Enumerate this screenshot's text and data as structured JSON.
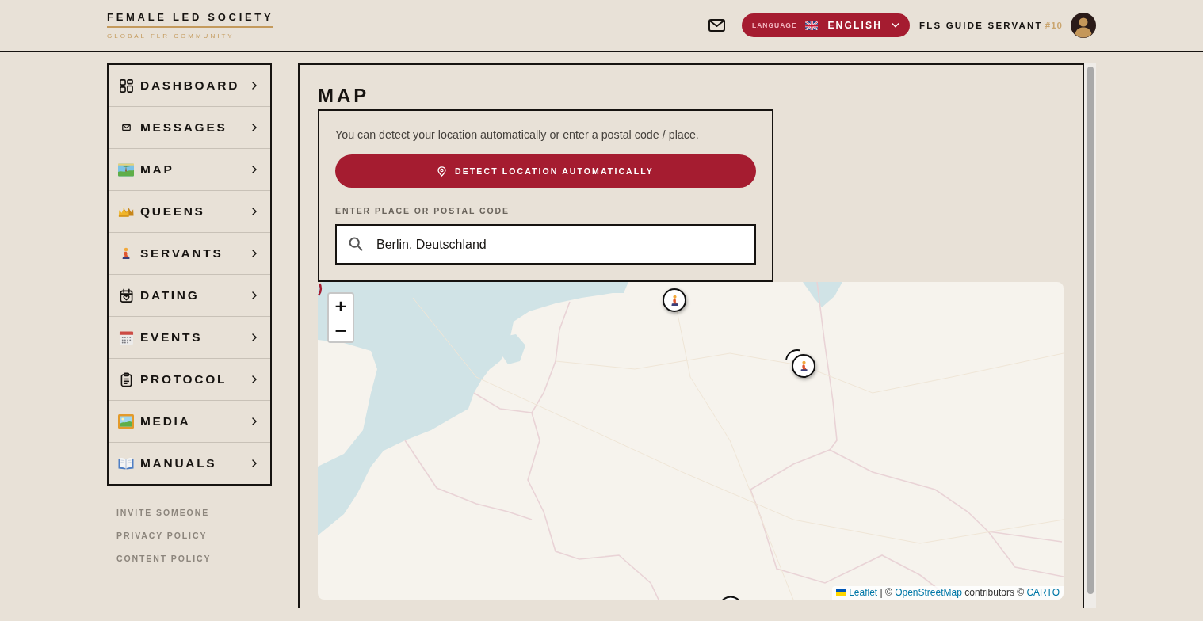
{
  "header": {
    "logo": {
      "title": "FEMALE LED SOCIETY",
      "tagline": "GLOBAL FLR COMMUNITY"
    },
    "language": {
      "label": "LANGUAGE",
      "value": "ENGLISH"
    },
    "user": {
      "name": "FLS GUIDE SERVANT",
      "rank": "#10"
    }
  },
  "sidebar": {
    "items": [
      "DASHBOARD",
      "MESSAGES",
      "MAP",
      "QUEENS",
      "SERVANTS",
      "DATING",
      "EVENTS",
      "PROTOCOL",
      "MEDIA",
      "MANUALS"
    ],
    "links": [
      "INVITE SOMEONE",
      "PRIVACY POLICY",
      "CONTENT POLICY"
    ]
  },
  "page": {
    "title": "MAP"
  },
  "location_card": {
    "hint": "You can detect your location automatically or enter a postal code / place.",
    "detect_button": "DETECT LOCATION AUTOMATICALLY",
    "field_label": "ENTER PLACE OR POSTAL CODE",
    "field_value": "Berlin, Deutschland"
  },
  "map": {
    "zoom_controls": [
      "+",
      "−"
    ],
    "attribution": [
      {
        "kind": "link",
        "text": "Leaflet"
      },
      {
        "kind": "text",
        "text": "| ©"
      },
      {
        "kind": "link",
        "text": "OpenStreetMap"
      },
      {
        "kind": "text",
        "text": "contributors ©"
      },
      {
        "kind": "link",
        "text": "CARTO"
      }
    ]
  }
}
